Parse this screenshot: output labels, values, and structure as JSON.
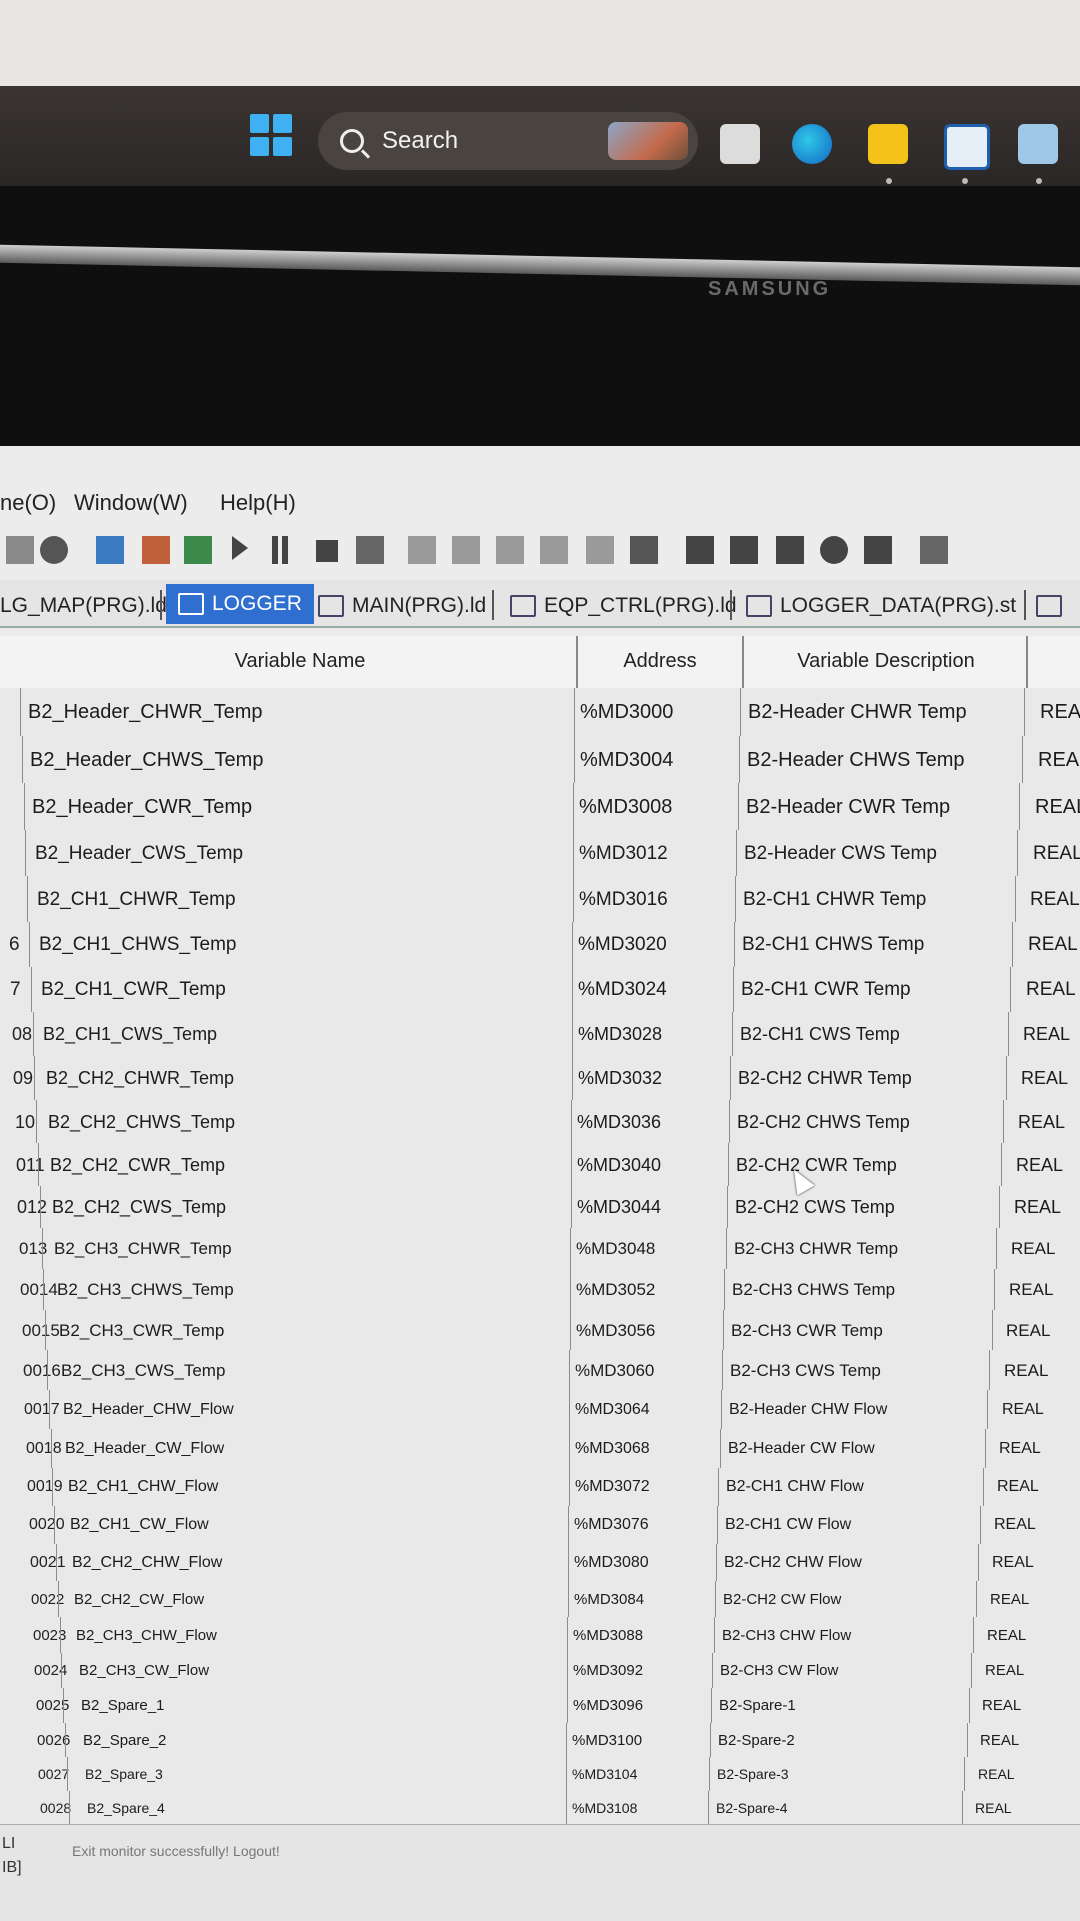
{
  "taskbar": {
    "search_label": "Search",
    "apps": [
      "task-view-icon",
      "edge-icon",
      "file-explorer-icon",
      "app-icon",
      "monitor-app-icon"
    ]
  },
  "monitor": {
    "brand": "SAMSUNG"
  },
  "menu": {
    "items": [
      "ne(O)",
      "Window(W)",
      "Help(H)"
    ]
  },
  "tabs": [
    {
      "label": "LG_MAP(PRG).ld",
      "active": false
    },
    {
      "label": "LOGGER",
      "active": true
    },
    {
      "label": "MAIN(PRG).ld",
      "active": false
    },
    {
      "label": "EQP_CTRL(PRG).ld",
      "active": false
    },
    {
      "label": "LOGGER_DATA(PRG).st",
      "active": false
    }
  ],
  "table": {
    "headers": {
      "name": "Variable Name",
      "address": "Address",
      "description": "Variable Description"
    },
    "rows": [
      {
        "num": "",
        "name": "B2_Header_CHWR_Temp",
        "address": "%MD3000",
        "description": "B2-Header CHWR Temp",
        "type": "REA"
      },
      {
        "num": "",
        "name": "B2_Header_CHWS_Temp",
        "address": "%MD3004",
        "description": "B2-Header CHWS Temp",
        "type": "REAL"
      },
      {
        "num": "",
        "name": "B2_Header_CWR_Temp",
        "address": "%MD3008",
        "description": "B2-Header CWR Temp",
        "type": "REAL"
      },
      {
        "num": "",
        "name": "B2_Header_CWS_Temp",
        "address": "%MD3012",
        "description": "B2-Header CWS Temp",
        "type": "REAL"
      },
      {
        "num": "",
        "name": "B2_CH1_CHWR_Temp",
        "address": "%MD3016",
        "description": "B2-CH1 CHWR Temp",
        "type": "REAL"
      },
      {
        "num": "6",
        "name": "B2_CH1_CHWS_Temp",
        "address": "%MD3020",
        "description": "B2-CH1 CHWS Temp",
        "type": "REAL"
      },
      {
        "num": "7",
        "name": "B2_CH1_CWR_Temp",
        "address": "%MD3024",
        "description": "B2-CH1 CWR Temp",
        "type": "REAL"
      },
      {
        "num": "08",
        "name": "B2_CH1_CWS_Temp",
        "address": "%MD3028",
        "description": "B2-CH1 CWS Temp",
        "type": "REAL"
      },
      {
        "num": "09",
        "name": "B2_CH2_CHWR_Temp",
        "address": "%MD3032",
        "description": "B2-CH2 CHWR Temp",
        "type": "REAL"
      },
      {
        "num": "10",
        "name": "B2_CH2_CHWS_Temp",
        "address": "%MD3036",
        "description": "B2-CH2 CHWS Temp",
        "type": "REAL"
      },
      {
        "num": "011",
        "name": "B2_CH2_CWR_Temp",
        "address": "%MD3040",
        "description": "B2-CH2 CWR Temp",
        "type": "REAL"
      },
      {
        "num": "012",
        "name": "B2_CH2_CWS_Temp",
        "address": "%MD3044",
        "description": "B2-CH2 CWS Temp",
        "type": "REAL"
      },
      {
        "num": "013",
        "name": "B2_CH3_CHWR_Temp",
        "address": "%MD3048",
        "description": "B2-CH3 CHWR Temp",
        "type": "REAL"
      },
      {
        "num": "0014",
        "name": "B2_CH3_CHWS_Temp",
        "address": "%MD3052",
        "description": "B2-CH3 CHWS Temp",
        "type": "REAL"
      },
      {
        "num": "0015",
        "name": "B2_CH3_CWR_Temp",
        "address": "%MD3056",
        "description": "B2-CH3 CWR Temp",
        "type": "REAL"
      },
      {
        "num": "0016",
        "name": "B2_CH3_CWS_Temp",
        "address": "%MD3060",
        "description": "B2-CH3 CWS Temp",
        "type": "REAL"
      },
      {
        "num": "0017",
        "name": "B2_Header_CHW_Flow",
        "address": "%MD3064",
        "description": "B2-Header CHW Flow",
        "type": "REAL"
      },
      {
        "num": "0018",
        "name": "B2_Header_CW_Flow",
        "address": "%MD3068",
        "description": "B2-Header CW Flow",
        "type": "REAL"
      },
      {
        "num": "0019",
        "name": "B2_CH1_CHW_Flow",
        "address": "%MD3072",
        "description": "B2-CH1 CHW Flow",
        "type": "REAL"
      },
      {
        "num": "0020",
        "name": "B2_CH1_CW_Flow",
        "address": "%MD3076",
        "description": "B2-CH1 CW Flow",
        "type": "REAL"
      },
      {
        "num": "0021",
        "name": "B2_CH2_CHW_Flow",
        "address": "%MD3080",
        "description": "B2-CH2 CHW Flow",
        "type": "REAL"
      },
      {
        "num": "0022",
        "name": "B2_CH2_CW_Flow",
        "address": "%MD3084",
        "description": "B2-CH2 CW Flow",
        "type": "REAL"
      },
      {
        "num": "0023",
        "name": "B2_CH3_CHW_Flow",
        "address": "%MD3088",
        "description": "B2-CH3 CHW Flow",
        "type": "REAL"
      },
      {
        "num": "0024",
        "name": "B2_CH3_CW_Flow",
        "address": "%MD3092",
        "description": "B2-CH3 CW Flow",
        "type": "REAL"
      },
      {
        "num": "0025",
        "name": "B2_Spare_1",
        "address": "%MD3096",
        "description": "B2-Spare-1",
        "type": "REAL"
      },
      {
        "num": "0026",
        "name": "B2_Spare_2",
        "address": "%MD3100",
        "description": "B2-Spare-2",
        "type": "REAL"
      },
      {
        "num": "0027",
        "name": "B2_Spare_3",
        "address": "%MD3104",
        "description": "B2-Spare-3",
        "type": "REAL"
      },
      {
        "num": "0028",
        "name": "B2_Spare_4",
        "address": "%MD3108",
        "description": "B2-Spare-4",
        "type": "REAL"
      }
    ]
  },
  "status": {
    "message": "Exit monitor successfully! Logout!",
    "left_1": "LI",
    "left_2": "IB]"
  },
  "colors": {
    "active_tab": "#2f6fd0",
    "windows_blue": "#3fb0f2"
  }
}
